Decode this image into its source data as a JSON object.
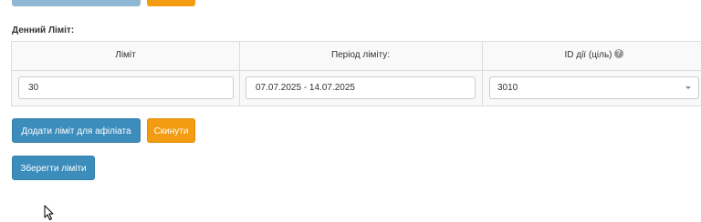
{
  "section": {
    "title": "Денний Ліміт:"
  },
  "table": {
    "headers": {
      "limit": "Ліміт",
      "period": "Період ліміту:",
      "action_id": "ID дії (ціль)"
    },
    "row": {
      "limit_value": "30",
      "period_value": "07.07.2025 - 14.07.2025",
      "action_id_value": "3010"
    }
  },
  "buttons": {
    "add_affiliate_limit": "Додати ліміт для афіліата",
    "reset": "Скинути",
    "save_limits": "Зберегти ліміти"
  },
  "icons": {
    "help": "question-circle-icon",
    "dropdown": "chevron-down-icon",
    "cursor": "mouse-pointer-icon"
  },
  "colors": {
    "primary": "#3c8dbc",
    "warning": "#f39c12"
  }
}
